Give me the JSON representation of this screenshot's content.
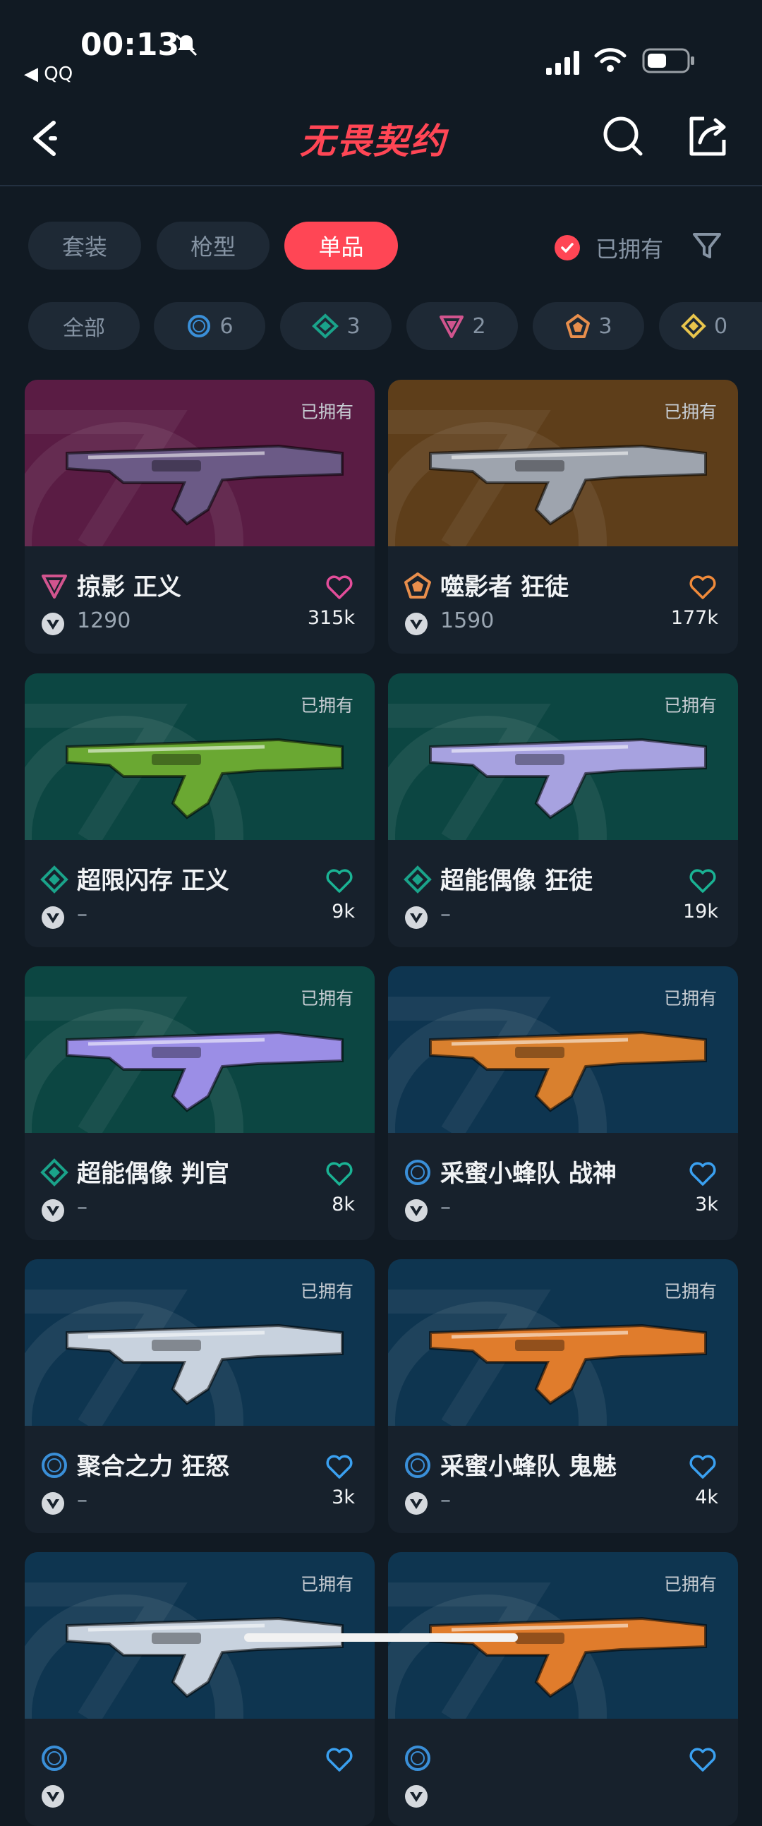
{
  "status_bar": {
    "time": "00:13",
    "back_app": "◀ QQ"
  },
  "header": {
    "title": "无畏契约"
  },
  "tabs": [
    {
      "label": "套装",
      "active": false
    },
    {
      "label": "枪型",
      "active": false
    },
    {
      "label": "单品",
      "active": true
    }
  ],
  "owned_filter": {
    "label": "已拥有",
    "checked": true
  },
  "tier_chips": [
    {
      "label": "全部",
      "icon": "none"
    },
    {
      "label": "6",
      "icon": "select-tier-icon",
      "color": "#3a8fd8"
    },
    {
      "label": "3",
      "icon": "deluxe-tier-icon",
      "color": "#1aa38a"
    },
    {
      "label": "2",
      "icon": "premium-tier-icon",
      "color": "#d1548e"
    },
    {
      "label": "3",
      "icon": "exclusive-tier-icon",
      "color": "#e88e4c"
    },
    {
      "label": "0",
      "icon": "ultra-tier-icon",
      "color": "#e8c54c"
    }
  ],
  "skins": [
    {
      "name": "掠影 正义",
      "owned": "已拥有",
      "price": "1290",
      "likes": "315k",
      "tier": "premium",
      "tier_color": "#d1548e",
      "heart_color": "#e34d9a",
      "bg": "#5a1c44",
      "weapon_color": "#6b5a86"
    },
    {
      "name": "噬影者 狂徒",
      "owned": "已拥有",
      "price": "1590",
      "likes": "177k",
      "tier": "exclusive",
      "tier_color": "#e88e4c",
      "heart_color": "#f08a3a",
      "bg": "#5e3e1a",
      "weapon_color": "#9ea4ae"
    },
    {
      "name": "超限闪存 正义",
      "owned": "已拥有",
      "price": "–",
      "likes": "9k",
      "tier": "deluxe",
      "tier_color": "#1aa38a",
      "heart_color": "#1ab394",
      "bg": "#0c4642",
      "weapon_color": "#6aa832"
    },
    {
      "name": "超能偶像 狂徒",
      "owned": "已拥有",
      "price": "–",
      "likes": "19k",
      "tier": "deluxe",
      "tier_color": "#1aa38a",
      "heart_color": "#1ab394",
      "bg": "#0c4642",
      "weapon_color": "#a7a2e0"
    },
    {
      "name": "超能偶像 判官",
      "owned": "已拥有",
      "price": "–",
      "likes": "8k",
      "tier": "deluxe",
      "tier_color": "#1aa38a",
      "heart_color": "#1ab394",
      "bg": "#0c4642",
      "weapon_color": "#9b8ee6"
    },
    {
      "name": "采蜜小蜂队 战神",
      "owned": "已拥有",
      "price": "–",
      "likes": "3k",
      "tier": "select",
      "tier_color": "#3a8fd8",
      "heart_color": "#3aa0f0",
      "bg": "#0e3550",
      "weapon_color": "#d9802e"
    },
    {
      "name": "聚合之力 狂怒",
      "owned": "已拥有",
      "price": "–",
      "likes": "3k",
      "tier": "select",
      "tier_color": "#3a8fd8",
      "heart_color": "#3aa0f0",
      "bg": "#0e3550",
      "weapon_color": "#c8d2de"
    },
    {
      "name": "采蜜小蜂队 鬼魅",
      "owned": "已拥有",
      "price": "–",
      "likes": "4k",
      "tier": "select",
      "tier_color": "#3a8fd8",
      "heart_color": "#3aa0f0",
      "bg": "#0e3550",
      "weapon_color": "#e07c2c"
    },
    {
      "name": "",
      "owned": "已拥有",
      "price": "",
      "likes": "",
      "tier": "select",
      "tier_color": "#3a8fd8",
      "heart_color": "#3aa0f0",
      "bg": "#0e3550",
      "weapon_color": "#c8d2de"
    },
    {
      "name": "",
      "owned": "已拥有",
      "price": "",
      "likes": "",
      "tier": "select",
      "tier_color": "#3a8fd8",
      "heart_color": "#3aa0f0",
      "bg": "#0e3550",
      "weapon_color": "#e07c2c"
    }
  ]
}
